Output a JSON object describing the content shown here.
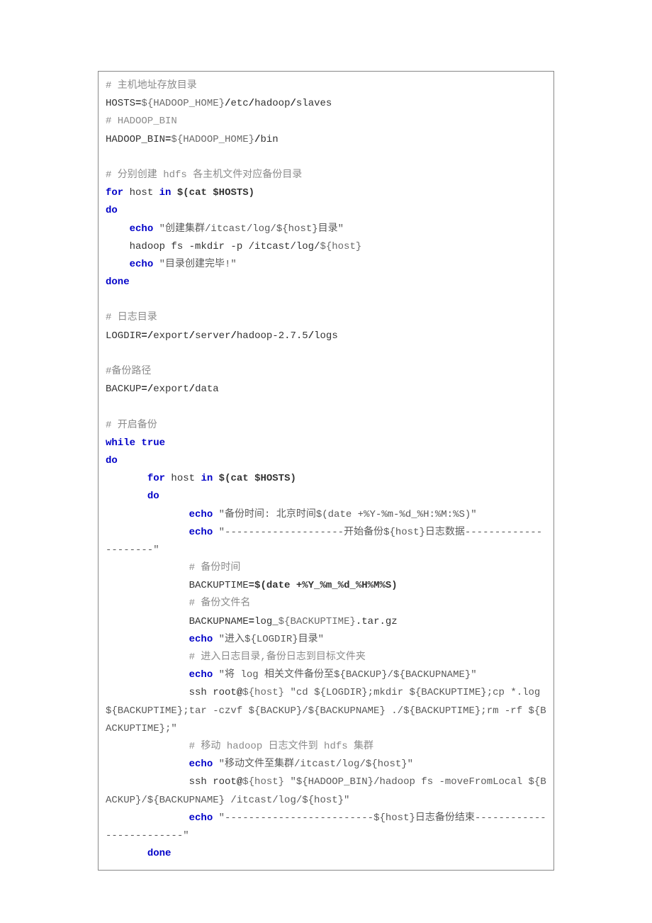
{
  "code": {
    "l01_a": "# 主机地址存放目录",
    "l02_a": "HOSTS",
    "l02_b": "=",
    "l02_c": "${HADOOP_HOME}",
    "l02_d": "/",
    "l02_e": "etc",
    "l02_f": "/",
    "l02_g": "hadoop",
    "l02_h": "/",
    "l02_i": "slaves",
    "l03_a": "# HADOOP_BIN",
    "l04_a": "HADOOP_BIN",
    "l04_b": "=",
    "l04_c": "${HADOOP_HOME}",
    "l04_d": "/",
    "l04_e": "bin",
    "l06_a": "# 分别创建 hdfs 各主机文件对应备份目录",
    "l07_a": "for",
    "l07_b": " host ",
    "l07_c": "in",
    "l07_d": " ",
    "l07_e": "$(cat $HOSTS)",
    "l08_a": "do",
    "l09_a": "    ",
    "l09_b": "echo",
    "l09_c": " \"创建集群/itcast/log/${host}目录\"",
    "l10_a": "    hadoop fs -mkdir -p /itcast/log/",
    "l10_b": "${host}",
    "l11_a": "    ",
    "l11_b": "echo",
    "l11_c": " \"目录创建完毕!\"",
    "l12_a": "done",
    "l14_a": "# 日志目录",
    "l15_a": "LOGDIR",
    "l15_b": "=",
    "l15_c": "/",
    "l15_d": "export",
    "l15_e": "/",
    "l15_f": "server",
    "l15_g": "/",
    "l15_h": "hadoop-2.7.5",
    "l15_i": "/",
    "l15_j": "logs",
    "l17_a": "#备份路径",
    "l18_a": "BACKUP",
    "l18_b": "=",
    "l18_c": "/",
    "l18_d": "export",
    "l18_e": "/",
    "l18_f": "data",
    "l20_a": "# 开启备份",
    "l21_a": "while",
    "l21_b": " ",
    "l21_c": "true",
    "l22_a": "do",
    "l23_a": "       ",
    "l23_b": "for",
    "l23_c": " host ",
    "l23_d": "in",
    "l23_e": " ",
    "l23_f": "$(cat $HOSTS)",
    "l24_a": "       ",
    "l24_b": "do",
    "l25_a": "              ",
    "l25_b": "echo",
    "l25_c": " \"备份时间: 北京时间$(date +%Y-%m-%d_%H:%M:%S)\"",
    "l26_a": "              ",
    "l26_b": "echo",
    "l26_c": " \"--------------------开始备份${host}日志数据---------------------\"",
    "l27_a": "              ",
    "l27_b": "# 备份时间",
    "l28_a": "              BACKUPTIME",
    "l28_b": "=",
    "l28_c": "$(date +%Y_%m_%d_%H%M%S)",
    "l29_a": "              ",
    "l29_b": "# 备份文件名",
    "l30_a": "              BACKUPNAME",
    "l30_b": "=",
    "l30_c": "log_",
    "l30_d": "${BACKUPTIME}",
    "l30_e": ".tar.gz",
    "l31_a": "              ",
    "l31_b": "echo",
    "l31_c": " \"进入${LOGDIR}目录\"",
    "l32_a": "              ",
    "l32_b": "# 进入日志目录,备份日志到目标文件夹",
    "l33_a": "              ",
    "l33_b": "echo",
    "l33_c": " \"将 log 相关文件备份至${BACKUP}/${BACKUPNAME}\"",
    "l34_a": "              ssh root",
    "l34_b": "@",
    "l34_c": "${host}",
    "l34_d": " \"cd ${LOGDIR};mkdir ${BACKUPTIME};cp *.log ${BACKUPTIME};tar -czvf ${BACKUP}/${BACKUPNAME} ./${BACKUPTIME};rm -rf ${BACKUPTIME};\"",
    "l35_a": "              ",
    "l35_b": "# 移动 hadoop 日志文件到 hdfs 集群",
    "l36_a": "              ",
    "l36_b": "echo",
    "l36_c": " \"移动文件至集群/itcast/log/${host}\"",
    "l37_a": "              ssh root",
    "l37_b": "@",
    "l37_c": "${host}",
    "l37_d": " \"${HADOOP_BIN}/hadoop fs -moveFromLocal ${BACKUP}/${BACKUPNAME} /itcast/log/${host}\"",
    "l38_a": "              ",
    "l38_b": "echo",
    "l38_c": " \"-------------------------${host}日志备份结束-------------------------\"",
    "l39_a": "       ",
    "l39_b": "done"
  }
}
